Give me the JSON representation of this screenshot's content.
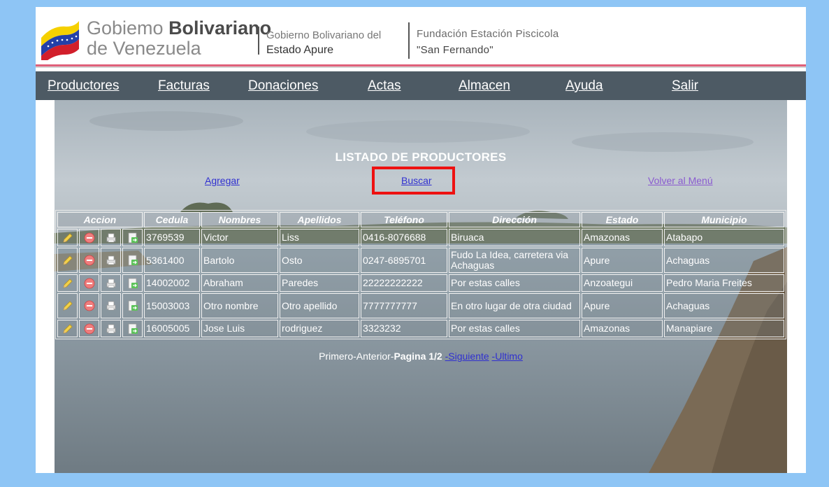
{
  "header": {
    "gov_line1_light": "Gobiemo ",
    "gov_line1_bold": "Bolivariano",
    "gov_line2": "de Venezuela",
    "state_line1": "Gobierno Bolivariano del",
    "state_line2": "Estado Apure",
    "fund_line1": "Fundación Estación Piscicola",
    "fund_line2": "\"San Fernando\""
  },
  "nav": {
    "items": [
      "Productores",
      "Facturas",
      "Donaciones",
      "Actas",
      "Almacen",
      "Ayuda",
      "Salir"
    ]
  },
  "main": {
    "title": "LISTADO DE PRODUCTORES",
    "add_link": "Agregar",
    "search_link": "Buscar",
    "back_link": "Volver al Menú"
  },
  "table": {
    "headers": [
      "Accion",
      "Cedula",
      "Nombres",
      "Apellidos",
      "Teléfono",
      "Dirección",
      "Estado",
      "Municipio"
    ],
    "rows": [
      {
        "cedula": "3769539",
        "nombres": "Victor",
        "apellidos": "Liss",
        "telefono": "0416-8076688",
        "direccion": "Biruaca",
        "estado": "Amazonas",
        "municipio": "Atabapo"
      },
      {
        "cedula": "5361400",
        "nombres": "Bartolo",
        "apellidos": "Osto",
        "telefono": "0247-6895701",
        "direccion": "Fudo La Idea, carretera via Achaguas",
        "estado": "Apure",
        "municipio": "Achaguas"
      },
      {
        "cedula": "14002002",
        "nombres": "Abraham",
        "apellidos": "Paredes",
        "telefono": "22222222222",
        "direccion": "Por estas calles",
        "estado": "Anzoategui",
        "municipio": "Pedro Maria Freites"
      },
      {
        "cedula": "15003003",
        "nombres": "Otro nombre",
        "apellidos": "Otro apellido",
        "telefono": "7777777777",
        "direccion": "En otro lugar de otra ciudad",
        "estado": "Apure",
        "municipio": "Achaguas"
      },
      {
        "cedula": "16005005",
        "nombres": "Jose Luis",
        "apellidos": "rodriguez",
        "telefono": "3323232",
        "direccion": "Por estas calles",
        "estado": "Amazonas",
        "municipio": "Manapiare"
      }
    ],
    "row_icons": [
      "edit-icon",
      "delete-icon",
      "print-icon",
      "export-icon"
    ]
  },
  "pager": {
    "first_prev": "Primero-Anterior-",
    "page_label": "Pagina 1/2",
    "next": "-Siguiente",
    "last": "-Ultimo"
  },
  "colors": {
    "nav_bg": "#4d5a64",
    "highlight": "#ee1111",
    "link": "#3030d0",
    "outer_bg": "#8ec5f5"
  }
}
